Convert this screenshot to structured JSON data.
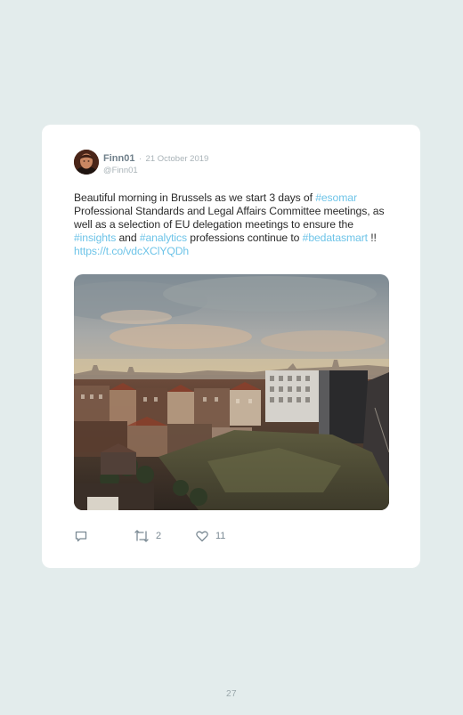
{
  "tweet": {
    "author": "Finn01",
    "separator": "·",
    "date": "21 October 2019",
    "handle": "@Finn01",
    "text_parts": {
      "p1": "Beautiful morning in Brussels as we start 3 days of ",
      "tag1": "#esomar",
      "p2": " Professional Standards and Legal Affairs Committee meetings, as well as a selection of EU delegation meetings to ensure the ",
      "tag2": "#insights",
      "p3": " and ",
      "tag3": "#analytics",
      "p4": " professions continue to ",
      "tag4": "#bedatasmart",
      "p5": " !! ",
      "link": "https://t.co/vdcXClYQDh"
    },
    "photo_icon": "city-skyline-photo",
    "actions": {
      "reply_icon": "reply-icon",
      "retweet_icon": "retweet-icon",
      "retweet_count": "2",
      "like_icon": "heart-icon",
      "like_count": "11"
    },
    "colors": {
      "hashtag": "#6ec4e8",
      "author": "#6f7f8a",
      "muted": "#a9b3b8"
    }
  },
  "page": {
    "number": "27",
    "background": "#e3ecec"
  }
}
